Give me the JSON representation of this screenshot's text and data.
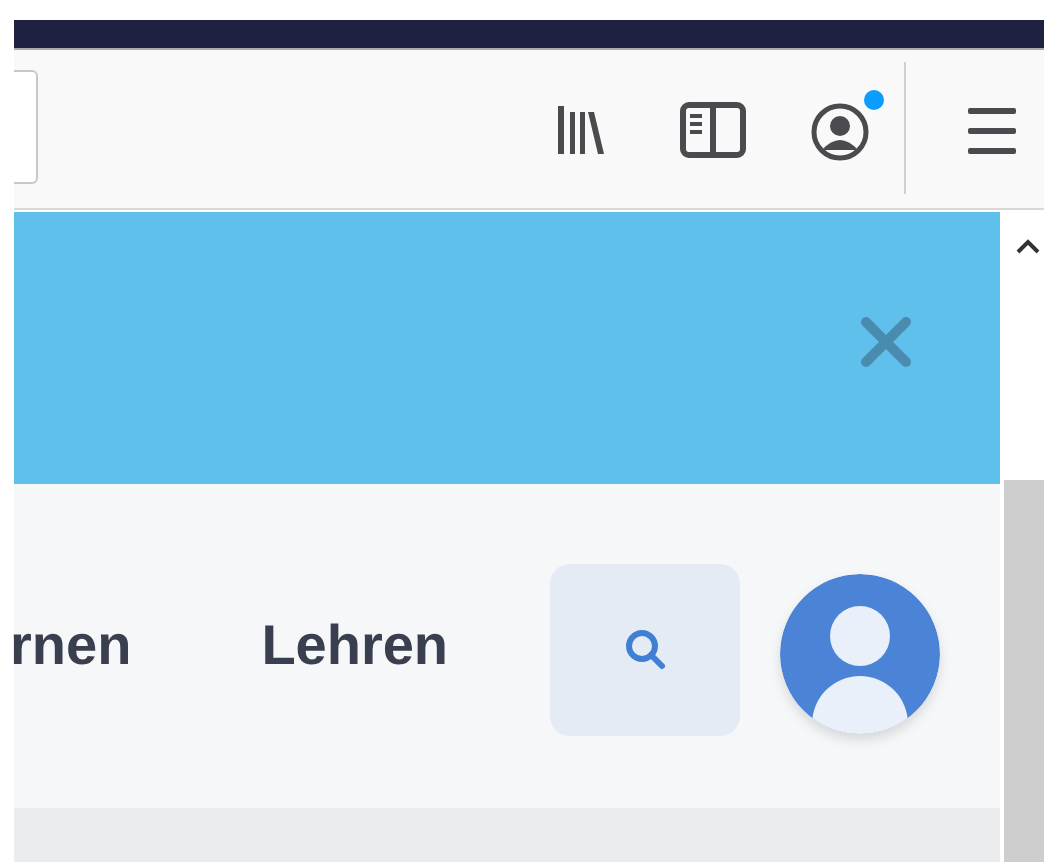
{
  "toolbar": {
    "account_notification": true
  },
  "banner": {
    "closable": true
  },
  "nav": {
    "links": [
      {
        "label": "rnen"
      },
      {
        "label": "Lehren"
      }
    ]
  }
}
